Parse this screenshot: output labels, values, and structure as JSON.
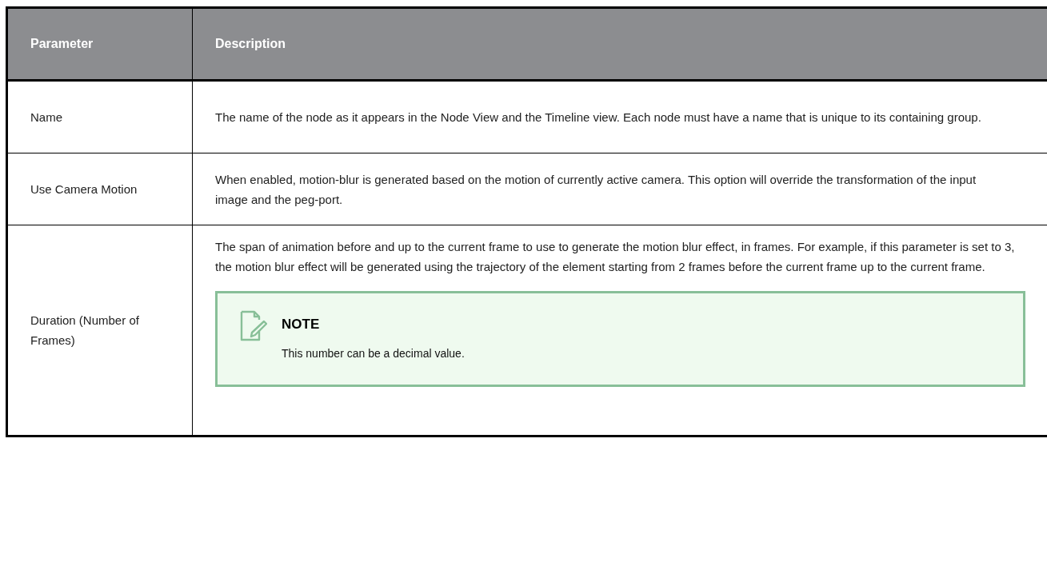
{
  "table": {
    "columns": [
      "Parameter",
      "Description"
    ],
    "rows": [
      {
        "parameter": "Name",
        "description": "The name of the node as it appears in the Node View and the Timeline view. Each node must have a name that is unique to its containing group."
      },
      {
        "parameter": "Use Camera Motion",
        "description": "When enabled, motion-blur is generated based on the motion of currently active camera. This option will override the transformation of the input image and the peg-port."
      },
      {
        "parameter": "Duration (Number of Frames)",
        "description": "The span of animation before and up to the current frame to use to generate the motion blur effect, in frames. For example, if this parameter is set to 3, the motion blur effect will be generated using the trajectory of the element starting from 2 frames before the current frame up to the current frame.",
        "note": {
          "title": "NOTE",
          "text": "This number can be a decimal value."
        }
      }
    ]
  }
}
